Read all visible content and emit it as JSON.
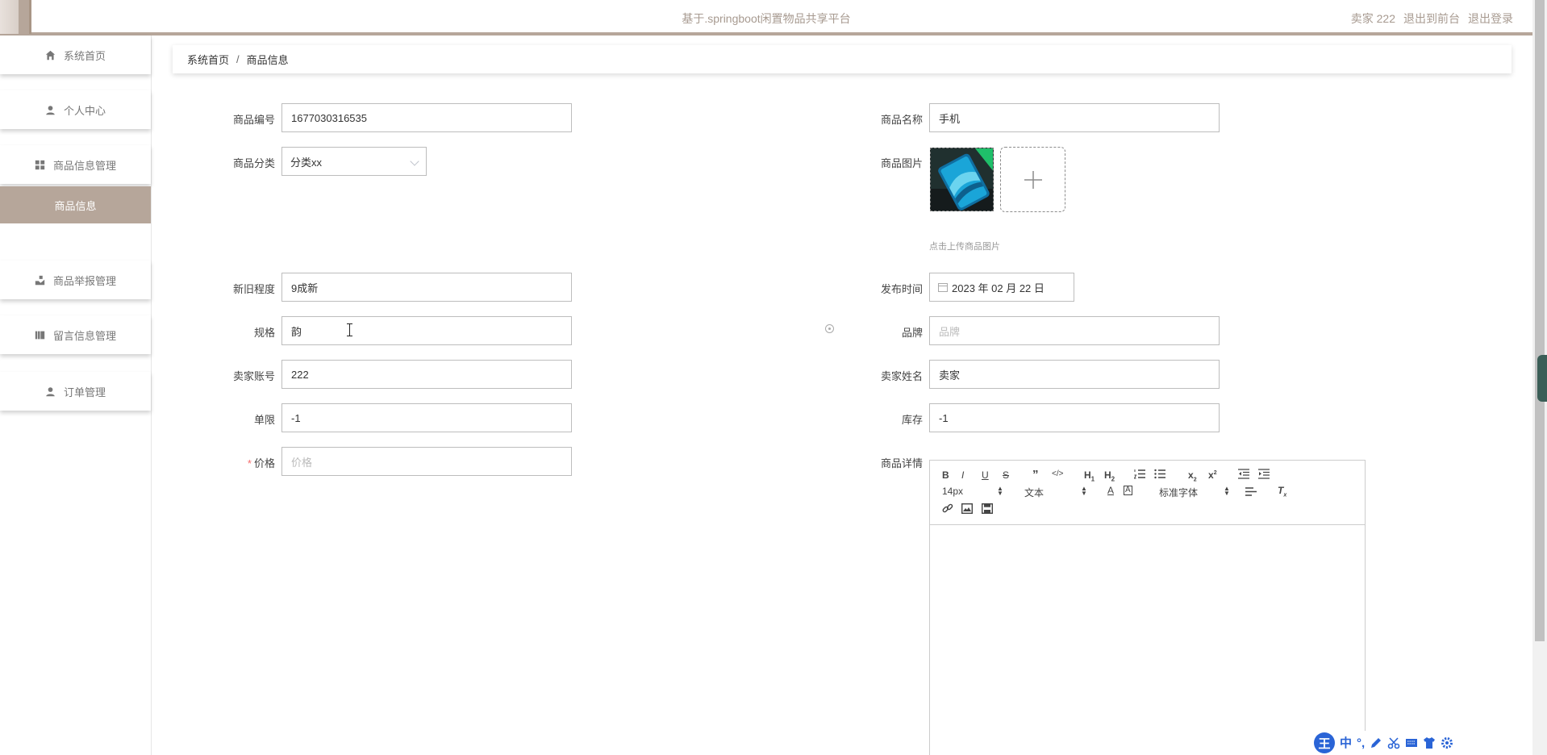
{
  "header": {
    "site_title": "基于.springboot闲置物品共享平台",
    "user_label": "卖家 222",
    "exit_front": "退出到前台",
    "logout": "退出登录"
  },
  "sidebar": {
    "items": [
      {
        "label": "系统首页",
        "icon": "home-icon"
      },
      {
        "label": "个人中心",
        "icon": "user-icon"
      },
      {
        "label": "商品信息管理",
        "icon": "grid-icon"
      },
      {
        "label": "商品举报管理",
        "icon": "report-icon"
      },
      {
        "label": "留言信息管理",
        "icon": "book-icon"
      },
      {
        "label": "订单管理",
        "icon": "user-icon"
      }
    ],
    "active_sub": "商品信息"
  },
  "breadcrumb": {
    "home": "系统首页",
    "separator": "/",
    "current": "商品信息"
  },
  "form": {
    "product_no": {
      "label": "商品编号",
      "value": "1677030316535"
    },
    "product_name": {
      "label": "商品名称",
      "value": "手机"
    },
    "category": {
      "label": "商品分类",
      "value": "分类xx"
    },
    "image": {
      "label": "商品图片",
      "hint": "点击上传商品图片"
    },
    "condition": {
      "label": "新旧程度",
      "value": "9成新"
    },
    "publish_time": {
      "label": "发布时间",
      "value": "2023 年 02 月 22 日"
    },
    "spec": {
      "label": "规格",
      "value": "韵"
    },
    "brand": {
      "label": "品牌",
      "placeholder": "品牌"
    },
    "seller_account": {
      "label": "卖家账号",
      "value": "222"
    },
    "seller_name": {
      "label": "卖家姓名",
      "value": "卖家"
    },
    "limit": {
      "label": "单限",
      "value": "-1"
    },
    "stock": {
      "label": "库存",
      "value": "-1"
    },
    "price": {
      "label": "价格",
      "placeholder": "价格",
      "required_mark": "*"
    },
    "detail": {
      "label": "商品详情"
    }
  },
  "editor": {
    "font_size": "14px",
    "text_type": "文本",
    "font_family": "标准字体"
  },
  "ime": {
    "badge": "王",
    "mode": "中"
  },
  "colors": {
    "accent": "#b6a69a",
    "ime_blue": "#2a64d6"
  }
}
